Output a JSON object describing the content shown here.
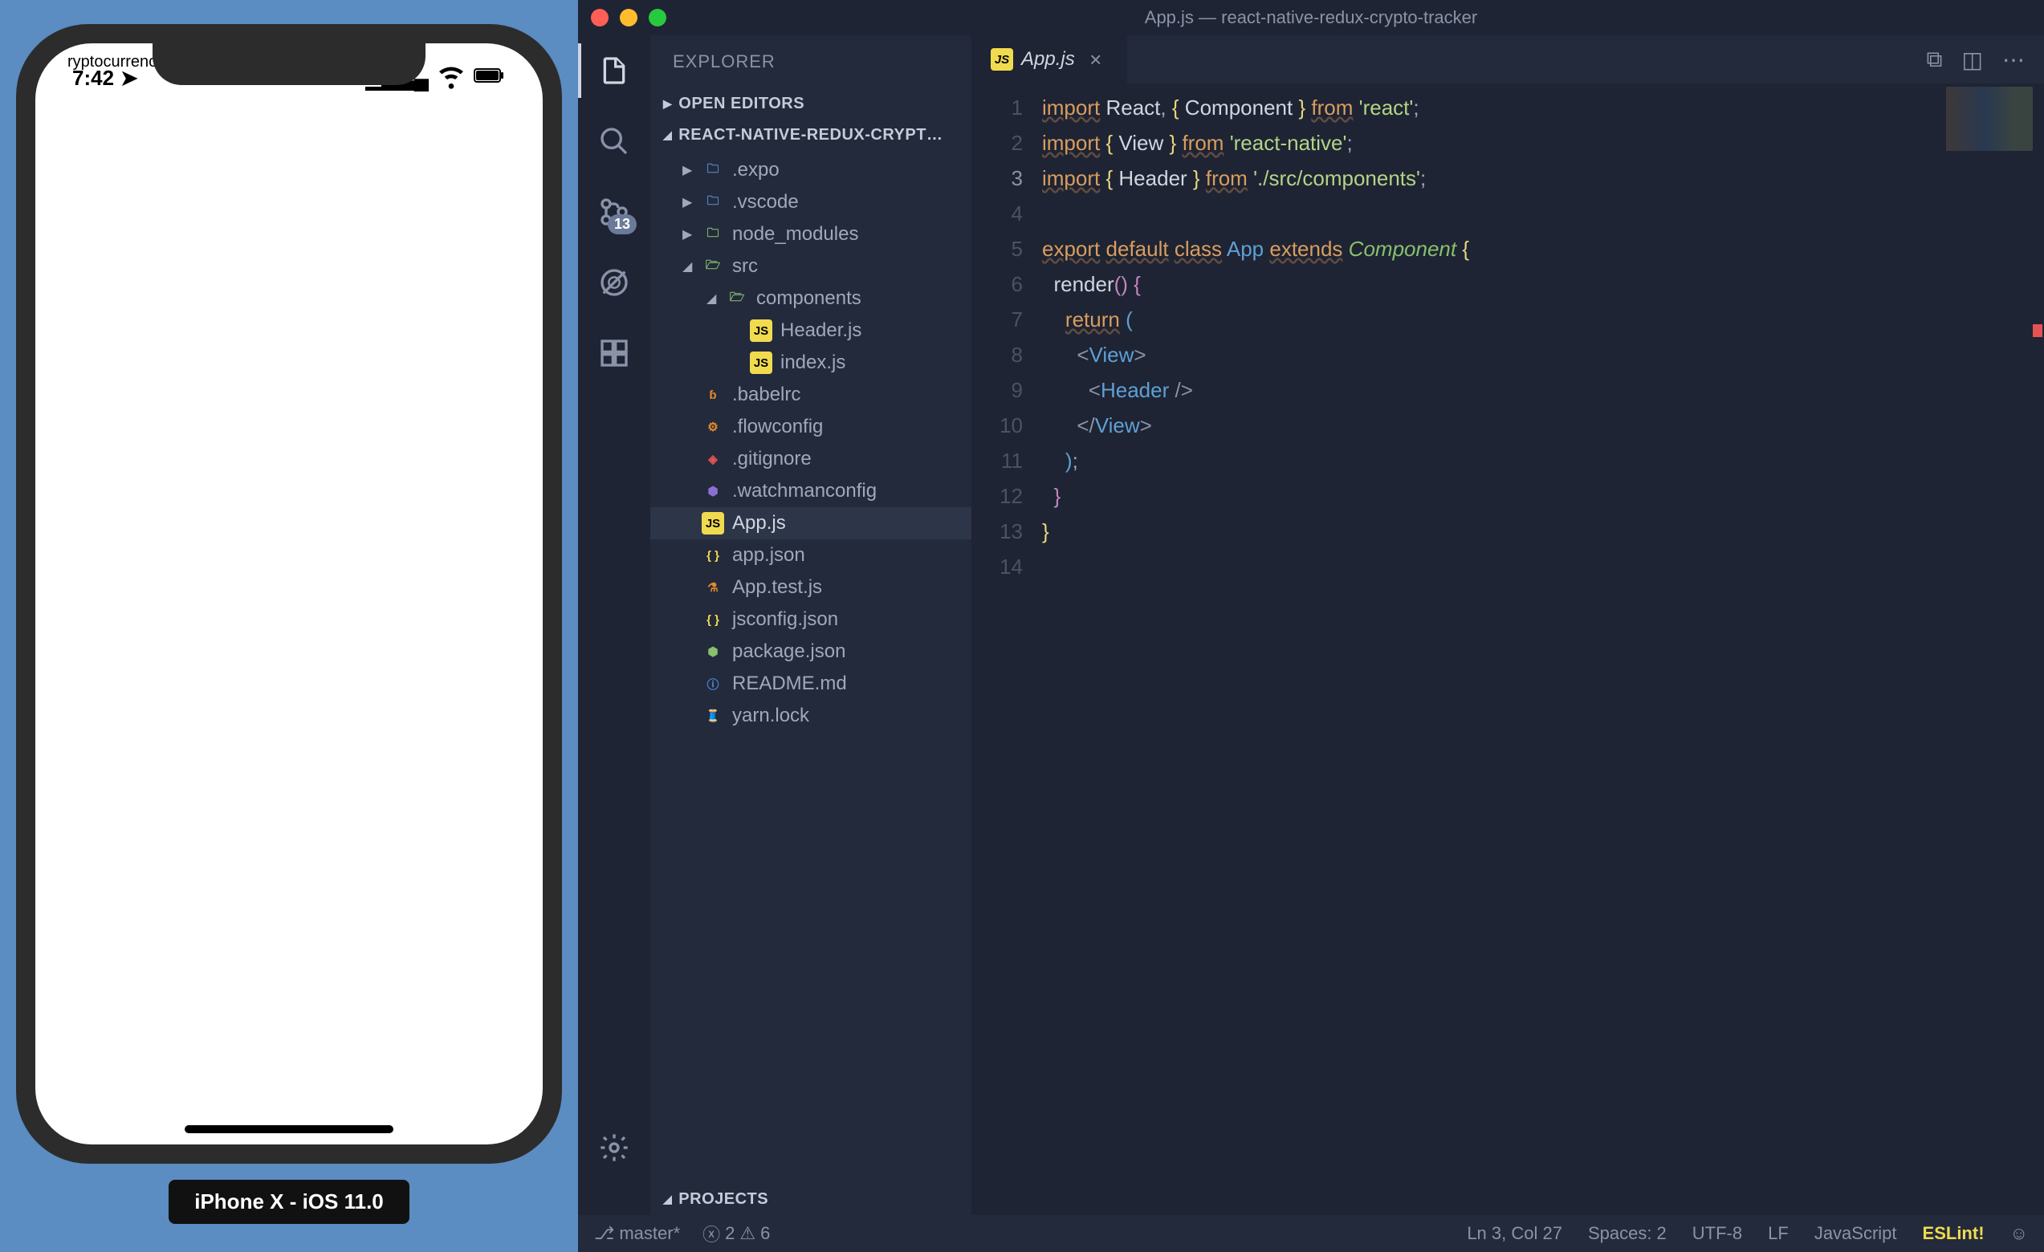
{
  "simulator": {
    "app_title_clip": "ryptocurrenc",
    "time": "7:42",
    "device_label": "iPhone X - iOS 11.0"
  },
  "vscode": {
    "titlebar": "App.js — react-native-redux-crypto-tracker",
    "activity_bar": {
      "scm_badge": "13"
    },
    "sidebar": {
      "header": "EXPLORER",
      "sections": {
        "open_editors": "OPEN EDITORS",
        "workspace": "REACT-NATIVE-REDUX-CRYPT…",
        "projects": "PROJECTS"
      },
      "tree": {
        "expo": ".expo",
        "vscode": ".vscode",
        "node_modules": "node_modules",
        "src": "src",
        "components": "components",
        "header_js": "Header.js",
        "index_js": "index.js",
        "babelrc": ".babelrc",
        "flowconfig": ".flowconfig",
        "gitignore": ".gitignore",
        "watchmanconfig": ".watchmanconfig",
        "app_js": "App.js",
        "app_json": "app.json",
        "app_test_js": "App.test.js",
        "jsconfig_json": "jsconfig.json",
        "package_json": "package.json",
        "readme_md": "README.md",
        "yarn_lock": "yarn.lock"
      }
    },
    "tabs": {
      "active_tab": "App.js"
    },
    "editor": {
      "line_numbers": [
        "1",
        "2",
        "3",
        "4",
        "5",
        "6",
        "7",
        "8",
        "9",
        "10",
        "11",
        "12",
        "13",
        "14"
      ],
      "current_line": 3,
      "code": {
        "l1_import": "import",
        "l1_w1": "React",
        "l1_comma": ",",
        "l1_b1": "{",
        "l1_w2": "Component",
        "l1_b2": "}",
        "l1_from": "from",
        "l1_str": "'react'",
        "l1_semi": ";",
        "l2_import": "import",
        "l2_b1": "{",
        "l2_w1": "View",
        "l2_b2": "}",
        "l2_from": "from",
        "l2_str": "'react-native'",
        "l2_semi": ";",
        "l3_import": "import",
        "l3_b1": "{",
        "l3_w1": "Header",
        "l3_b2": "}",
        "l3_from": "from",
        "l3_str": "'./src/components'",
        "l3_semi": ";",
        "l5_export": "export",
        "l5_default": "default",
        "l5_class": "class",
        "l5_app": "App",
        "l5_extends": "extends",
        "l5_comp": "Component",
        "l5_br": "{",
        "l6_render": "render",
        "l6_paren": "()",
        "l6_br": "{",
        "l7_return": "return",
        "l7_paren": "(",
        "l8_lt": "<",
        "l8_tag": "View",
        "l8_gt": ">",
        "l9_lt": "<",
        "l9_tag": "Header",
        "l9_slash": "/>",
        "l10_lt": "</",
        "l10_tag": "View",
        "l10_gt": ">",
        "l11_paren": ")",
        "l11_semi": ";",
        "l12_br": "}",
        "l13_br": "}"
      }
    },
    "statusbar": {
      "branch": "master*",
      "errors": "2",
      "warnings": "6",
      "cursor": "Ln 3, Col 27",
      "spaces": "Spaces: 2",
      "encoding": "UTF-8",
      "eol": "LF",
      "language": "JavaScript",
      "eslint": "ESLint!"
    }
  }
}
